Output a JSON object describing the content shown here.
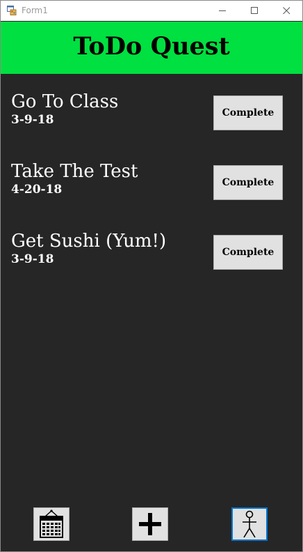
{
  "window": {
    "title": "Form1"
  },
  "header": {
    "title": "ToDo Quest",
    "background_color": "#00e040"
  },
  "tasks": [
    {
      "name": "Go To Class",
      "date": "3-9-18",
      "action_label": "Complete"
    },
    {
      "name": "Take The Test",
      "date": "4-20-18",
      "action_label": "Complete"
    },
    {
      "name": "Get Sushi (Yum!)",
      "date": "3-9-18",
      "action_label": "Complete"
    }
  ],
  "toolbar": {
    "buttons": [
      {
        "icon": "calendar-icon"
      },
      {
        "icon": "plus-icon"
      },
      {
        "icon": "stick-figure-icon"
      }
    ]
  },
  "colors": {
    "background": "#262626",
    "button_face": "#e1e1e1",
    "focus_border": "#0078d7"
  }
}
